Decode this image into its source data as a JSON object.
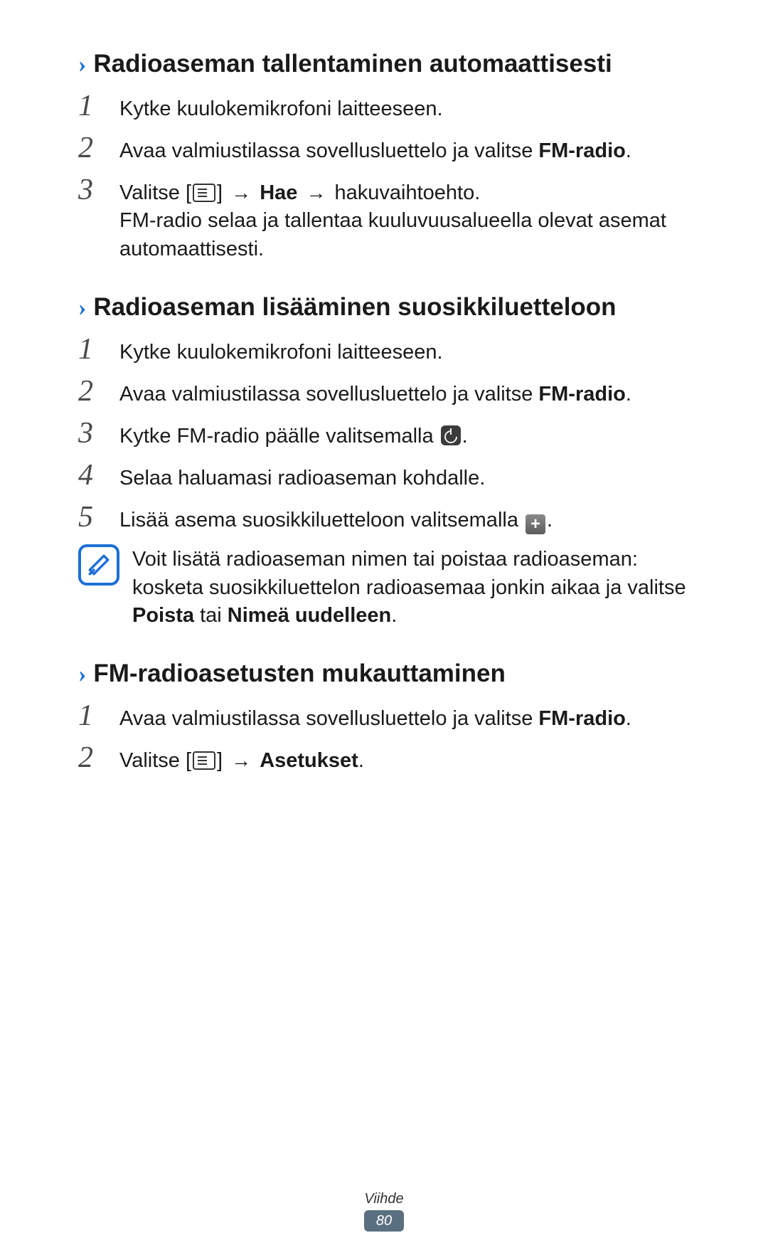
{
  "sections": [
    {
      "title": "Radioaseman tallentaminen automaattisesti",
      "steps": [
        {
          "num": "1",
          "parts": [
            {
              "t": "Kytke kuulokemikrofoni laitteeseen."
            }
          ]
        },
        {
          "num": "2",
          "parts": [
            {
              "t": "Avaa valmiustilassa sovellusluettelo ja valitse "
            },
            {
              "t": "FM-radio",
              "bold": true
            },
            {
              "t": "."
            }
          ]
        },
        {
          "num": "3",
          "parts": [
            {
              "t": "Valitse ["
            },
            {
              "icon": "menu"
            },
            {
              "t": "] "
            },
            {
              "arrow": true
            },
            {
              "t": " "
            },
            {
              "t": "Hae",
              "bold": true
            },
            {
              "t": " "
            },
            {
              "arrow": true
            },
            {
              "t": " hakuvaihtoehto."
            },
            {
              "br": true
            },
            {
              "t": "FM-radio selaa ja tallentaa kuuluvuusalueella olevat asemat automaattisesti."
            }
          ]
        }
      ]
    },
    {
      "title": "Radioaseman lisääminen suosikkiluetteloon",
      "steps": [
        {
          "num": "1",
          "parts": [
            {
              "t": "Kytke kuulokemikrofoni laitteeseen."
            }
          ]
        },
        {
          "num": "2",
          "parts": [
            {
              "t": "Avaa valmiustilassa sovellusluettelo ja valitse "
            },
            {
              "t": "FM-radio",
              "bold": true
            },
            {
              "t": "."
            }
          ]
        },
        {
          "num": "3",
          "parts": [
            {
              "t": "Kytke FM-radio päälle valitsemalla "
            },
            {
              "icon": "power"
            },
            {
              "t": "."
            }
          ]
        },
        {
          "num": "4",
          "parts": [
            {
              "t": "Selaa haluamasi radioaseman kohdalle."
            }
          ]
        },
        {
          "num": "5",
          "parts": [
            {
              "t": "Lisää asema suosikkiluetteloon valitsemalla "
            },
            {
              "icon": "plus"
            },
            {
              "t": "."
            }
          ]
        }
      ],
      "note": {
        "parts": [
          {
            "t": "Voit lisätä radioaseman nimen tai poistaa radioaseman: kosketa suosikkiluettelon radioasemaa jonkin aikaa ja valitse "
          },
          {
            "t": "Poista",
            "bold": true
          },
          {
            "t": " tai "
          },
          {
            "t": "Nimeä uudelleen",
            "bold": true
          },
          {
            "t": "."
          }
        ]
      }
    },
    {
      "title": "FM-radioasetusten mukauttaminen",
      "steps": [
        {
          "num": "1",
          "parts": [
            {
              "t": "Avaa valmiustilassa sovellusluettelo ja valitse "
            },
            {
              "t": "FM-radio",
              "bold": true
            },
            {
              "t": "."
            }
          ]
        },
        {
          "num": "2",
          "parts": [
            {
              "t": "Valitse ["
            },
            {
              "icon": "menu"
            },
            {
              "t": "] "
            },
            {
              "arrow": true
            },
            {
              "t": " "
            },
            {
              "t": "Asetukset",
              "bold": true
            },
            {
              "t": "."
            }
          ]
        }
      ]
    }
  ],
  "footer": {
    "label": "Viihde",
    "page": "80"
  }
}
